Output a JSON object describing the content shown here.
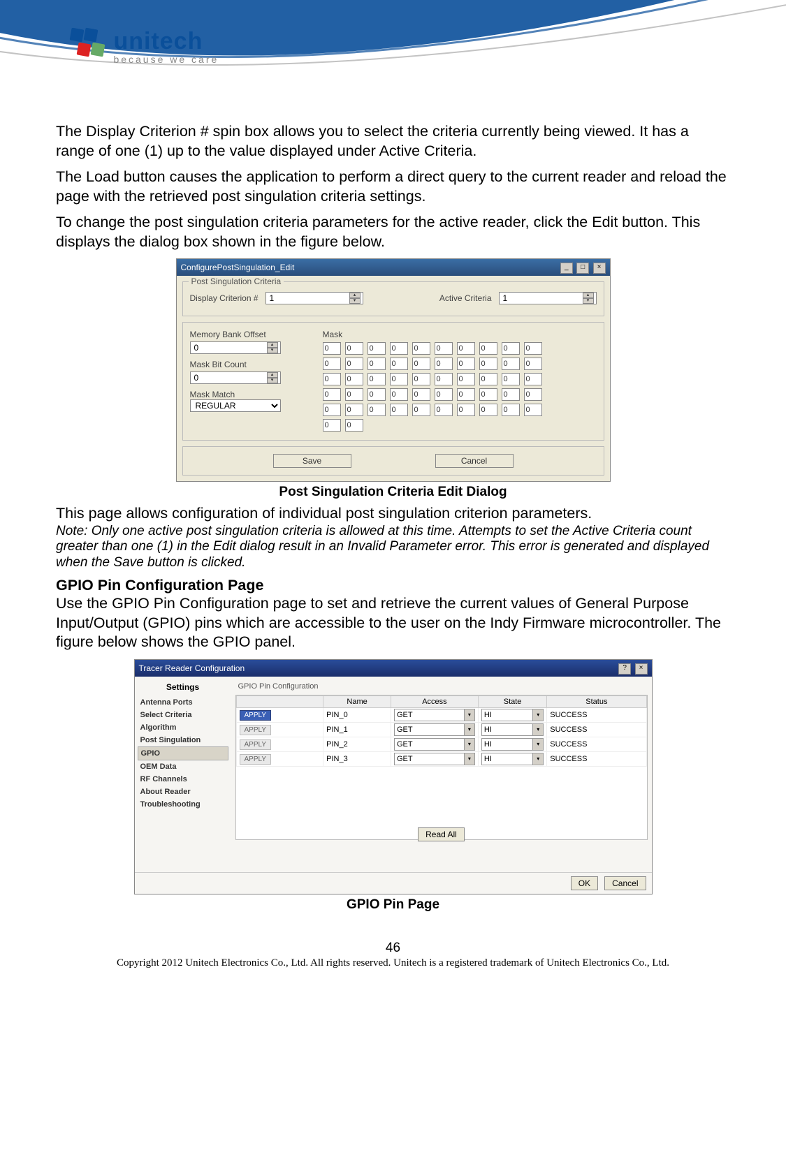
{
  "logo": {
    "brand": "unitech",
    "tag": "because we care"
  },
  "para1": "The Display Criterion # spin box allows you to select the criteria currently being viewed. It has a range of one (1) up to the value displayed under Active Criteria.",
  "para2": "The Load button causes the application to perform a direct query to the current reader and reload the page with the retrieved post singulation criteria settings.",
  "para3": "To change the post singulation criteria parameters for the active reader, click the Edit button. This displays the dialog box shown in the figure below.",
  "dialog1": {
    "title": "ConfigurePostSingulation_Edit",
    "group_title": "Post Singulation Criteria",
    "display_criterion_label": "Display Criterion #",
    "display_criterion_value": "1",
    "active_criteria_label": "Active Criteria",
    "active_criteria_value": "1",
    "mem_bank_offset_label": "Memory Bank Offset",
    "mem_bank_offset_value": "0",
    "mask_bit_count_label": "Mask Bit Count",
    "mask_bit_count_value": "0",
    "mask_match_label": "Mask Match",
    "mask_match_value": "REGULAR",
    "mask_label": "Mask",
    "mask_cell_value": "0",
    "save_label": "Save",
    "cancel_label": "Cancel"
  },
  "caption1": "Post Singulation Criteria Edit Dialog",
  "para4": "This page allows configuration of individual post singulation criterion parameters.",
  "note1": "Note: Only one active post singulation criteria is allowed at this time.   Attempts to set the Active Criteria count greater than one (1) in the Edit dialog result in an Invalid Parameter error. This error is generated and displayed when the Save button is clicked.",
  "heading_gpio": "GPIO Pin Configuration Page",
  "para5": "Use the GPIO Pin Configuration page to set and retrieve the current values of General Purpose Input/Output (GPIO) pins which are accessible to the user on the Indy Firmware microcontroller. The figure below shows the GPIO panel.",
  "dialog2": {
    "title": "Tracer Reader Configuration",
    "sidenav_title": "Settings",
    "nav": [
      "Antenna Ports",
      "Select Criteria",
      "Algorithm",
      "Post Singulation",
      "GPIO",
      "OEM Data",
      "RF Channels",
      "About Reader",
      "Troubleshooting"
    ],
    "pane_title": "GPIO Pin Configuration",
    "columns": [
      "",
      "Name",
      "Access",
      "State",
      "Status"
    ],
    "rows": [
      {
        "apply": "APPLY",
        "name": "PIN_0",
        "access": "GET",
        "state": "HI",
        "status": "SUCCESS"
      },
      {
        "apply": "APPLY",
        "name": "PIN_1",
        "access": "GET",
        "state": "HI",
        "status": "SUCCESS"
      },
      {
        "apply": "APPLY",
        "name": "PIN_2",
        "access": "GET",
        "state": "HI",
        "status": "SUCCESS"
      },
      {
        "apply": "APPLY",
        "name": "PIN_3",
        "access": "GET",
        "state": "HI",
        "status": "SUCCESS"
      }
    ],
    "read_all_label": "Read All",
    "ok_label": "OK",
    "cancel_label": "Cancel"
  },
  "caption2": "GPIO Pin Page",
  "page_number": "46",
  "copyright": "Copyright 2012 Unitech Electronics Co., Ltd. All rights reserved. Unitech is a registered trademark of Unitech Electronics Co., Ltd."
}
